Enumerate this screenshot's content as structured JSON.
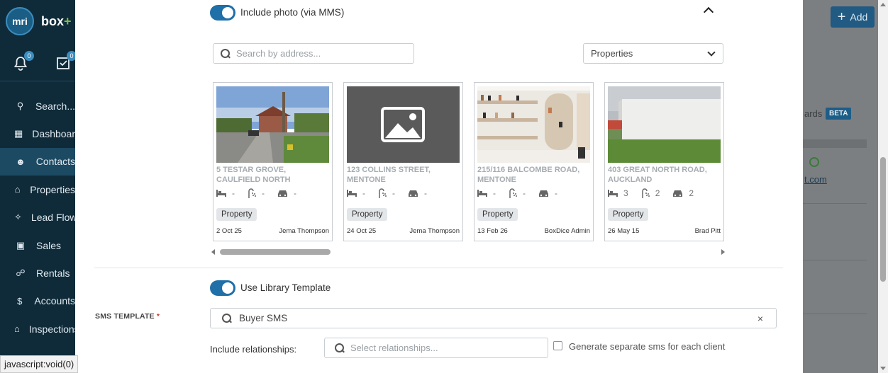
{
  "sidebar": {
    "logo_text": "mri",
    "brand_main": "box",
    "brand_plus": "+",
    "notifications_count": "0",
    "tasks_count": "0",
    "items": [
      {
        "label": "Search...",
        "icon": "search-icon"
      },
      {
        "label": "Dashboard",
        "icon": "dashboard-icon"
      },
      {
        "label": "Contacts",
        "icon": "user-icon",
        "active": true
      },
      {
        "label": "Properties",
        "icon": "home-icon"
      },
      {
        "label": "Lead Flow",
        "icon": "lead-flow-icon"
      },
      {
        "label": "Sales",
        "icon": "sales-icon"
      },
      {
        "label": "Rentals",
        "icon": "key-icon"
      },
      {
        "label": "Accounts",
        "icon": "dollar-icon"
      },
      {
        "label": "Inspections",
        "icon": "inspection-icon"
      }
    ]
  },
  "background": {
    "add_button_label": "Add",
    "boards_text": "ards",
    "beta_badge": "BETA",
    "email_fragment": "t.com"
  },
  "modal": {
    "include_photo_label": "Include photo (via MMS)",
    "search_placeholder": "Search by address...",
    "filter_select_value": "Properties",
    "properties": [
      {
        "address": "5 TESTAR GROVE, CAULFIELD NORTH",
        "beds": "-",
        "baths": "-",
        "cars": "-",
        "tag": "Property",
        "date": "2 Oct 25",
        "agent": "Jema Thompson",
        "photo": "street"
      },
      {
        "address": "123 COLLINS STREET, MENTONE",
        "beds": "-",
        "baths": "-",
        "cars": "-",
        "tag": "Property",
        "date": "24 Oct 25",
        "agent": "Jema Thompson",
        "photo": "placeholder"
      },
      {
        "address": "215/116 BALCOMBE ROAD, MENTONE",
        "beds": "-",
        "baths": "-",
        "cars": "-",
        "tag": "Property",
        "date": "13 Feb 26",
        "agent": "BoxDice Admin",
        "photo": "shelves"
      },
      {
        "address": "403 GREAT NORTH ROAD, AUCKLAND",
        "beds": "3",
        "baths": "2",
        "cars": "2",
        "tag": "Property",
        "date": "26 May 15",
        "agent": "Brad Pitt",
        "photo": "building"
      }
    ],
    "use_library_template_label": "Use Library Template",
    "sms_template_label": "SMS TEMPLATE",
    "sms_template_required": "*",
    "sms_template_value": "Buyer SMS",
    "clear_symbol": "×",
    "include_relationships_label": "Include relationships:",
    "relationships_placeholder": "Select relationships...",
    "generate_separate_label": "Generate separate sms for each client"
  },
  "status_bar_text": "javascript:void(0)",
  "colors": {
    "sidebar_bg": "#0f2b3a",
    "toggle_on": "#1f6fa8",
    "accent": "#215a82"
  }
}
